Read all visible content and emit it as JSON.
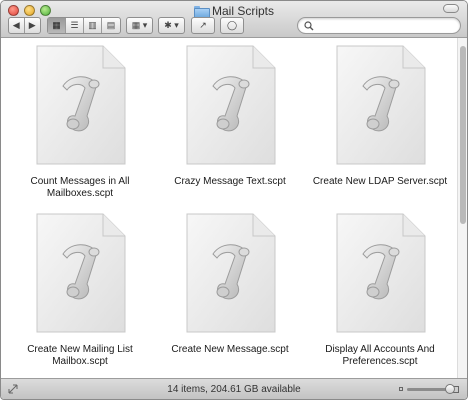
{
  "window": {
    "title": "Mail Scripts"
  },
  "toolbar": {
    "back_icon": "left-triangle-icon",
    "forward_icon": "right-triangle-icon",
    "views": [
      {
        "name": "icon-view",
        "glyph": "▦",
        "active": true
      },
      {
        "name": "list-view",
        "glyph": "☰",
        "active": false
      },
      {
        "name": "column-view",
        "glyph": "▥",
        "active": false
      },
      {
        "name": "coverflow-view",
        "glyph": "▤",
        "active": false
      }
    ],
    "arrange_glyph": "▦ ▾",
    "action_glyph": "✱ ▾",
    "share_glyph": "↗",
    "tag_glyph": "◯",
    "search_placeholder": ""
  },
  "files": [
    {
      "name": "Count Messages in All Mailboxes.scpt"
    },
    {
      "name": "Crazy Message Text.scpt"
    },
    {
      "name": "Create New LDAP Server.scpt"
    },
    {
      "name": "Create New Mailing List Mailbox.scpt"
    },
    {
      "name": "Create New Message.scpt"
    },
    {
      "name": "Display All Accounts And Preferences.scpt"
    }
  ],
  "status": {
    "text": "14 items, 204.61 GB available"
  },
  "colors": {
    "toolbar_top": "#eaeaea",
    "toolbar_bottom": "#c9c9c9",
    "window_bg": "#ffffff"
  }
}
